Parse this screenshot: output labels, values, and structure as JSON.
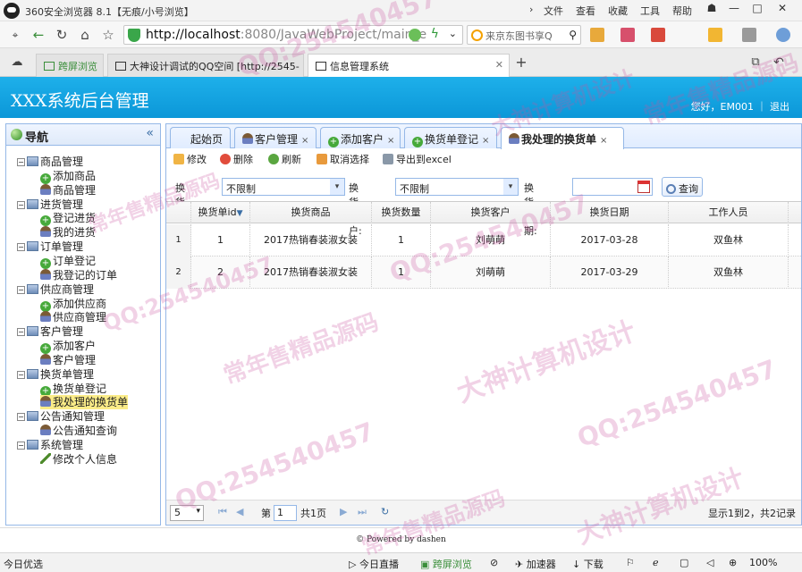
{
  "browser": {
    "title": "360安全浏览器 8.1【无痕/小号浏览】",
    "menu": [
      "文件",
      "查看",
      "收藏",
      "工具",
      "帮助"
    ],
    "url_host": "http://localhost",
    "url_path": ":8080/JavaWebProject/main_e",
    "search_placeholder": "来京东图书享Q",
    "tabs": [
      {
        "label": "跨屏浏览"
      },
      {
        "label": "大神设计调试的QQ空间 [http://2545-"
      },
      {
        "label": "信息管理系统"
      }
    ],
    "new_tab": "+"
  },
  "header": {
    "title": "XXX系统后台管理",
    "user_info": "您好，EM001 ｜ 退出"
  },
  "nav": {
    "title": "导航",
    "groups": [
      {
        "label": "商品管理",
        "items": [
          "添加商品",
          "商品管理"
        ]
      },
      {
        "label": "进货管理",
        "items": [
          "登记进货",
          "我的进货"
        ]
      },
      {
        "label": "订单管理",
        "items": [
          "订单登记",
          "我登记的订单"
        ]
      },
      {
        "label": "供应商管理",
        "items": [
          "添加供应商",
          "供应商管理"
        ]
      },
      {
        "label": "客户管理",
        "items": [
          "添加客户",
          "客户管理"
        ]
      },
      {
        "label": "换货单管理",
        "items": [
          "换货单登记",
          "我处理的换货单"
        ]
      },
      {
        "label": "公告通知管理",
        "items": [
          "公告通知查询"
        ]
      },
      {
        "label": "系统管理",
        "items": [
          "修改个人信息"
        ]
      }
    ]
  },
  "panel_tabs": [
    {
      "label": "起始页"
    },
    {
      "label": "客户管理"
    },
    {
      "label": "添加客户"
    },
    {
      "label": "换货单登记"
    },
    {
      "label": "我处理的换货单"
    }
  ],
  "toolbar": {
    "edit": "修改",
    "delete": "删除",
    "refresh": "刷新",
    "cancel_select": "取消选择",
    "export": "导出到excel"
  },
  "filters": {
    "product_label": "换货商品:",
    "product_value": "不限制",
    "customer_label": "换货客户:",
    "customer_value": "不限制",
    "date_label": "换货日期:",
    "date_value": "",
    "query_button": "查询"
  },
  "grid": {
    "columns": [
      "换货单id",
      "换货商品",
      "换货数量",
      "换货客户",
      "换货日期",
      "工作人员"
    ],
    "rows": [
      {
        "num": "1",
        "id": "1",
        "product": "2017热销春装淑女装",
        "qty": "1",
        "customer": "刘萌萌",
        "date": "2017-03-28",
        "staff": "双鱼林"
      },
      {
        "num": "2",
        "id": "2",
        "product": "2017热销春装淑女装",
        "qty": "1",
        "customer": "刘萌萌",
        "date": "2017-03-29",
        "staff": "双鱼林"
      }
    ]
  },
  "pager": {
    "page_size": "5",
    "page_prefix": "第",
    "page_number": "1",
    "page_total": "共1页",
    "summary": "显示1到2，共2记录"
  },
  "footer": {
    "powered": "Powered by dashen"
  },
  "statusbar": {
    "left": "今日优选",
    "live": "今日直播",
    "cross": "跨屏浏览",
    "accelerator": "加速器",
    "download": "下载",
    "zoom": "100%"
  },
  "watermark": {
    "qq": "QQ:254540457",
    "studio": "大神计算机设计",
    "shop": "常年售精品源码"
  },
  "colors": {
    "header": "#0b97d8",
    "nav_border": "#95b8e7",
    "selected": "#fbec88"
  }
}
